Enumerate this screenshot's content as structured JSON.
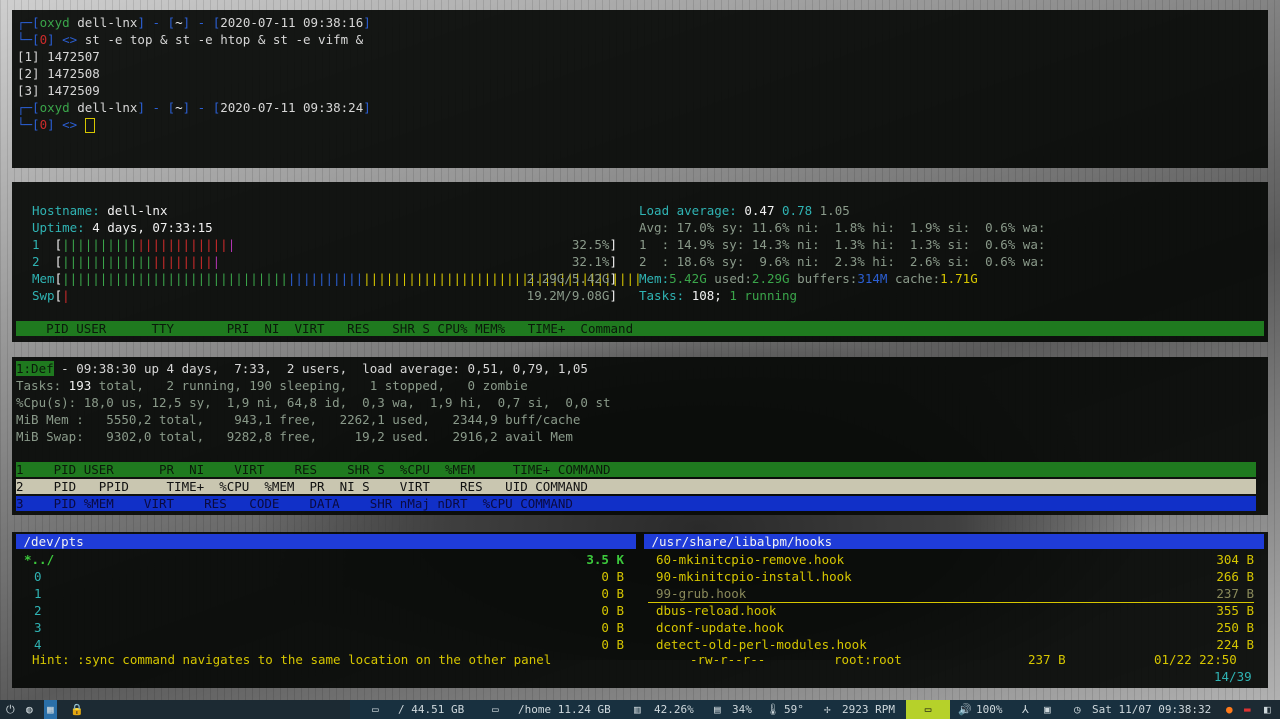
{
  "shell": {
    "prompt1": {
      "user": "oxyd",
      "host": "dell-lnx",
      "dir": "~",
      "time": "2020-07-11 09:38:16"
    },
    "cmd": "st -e top & st -e htop & st -e vifm &",
    "jobs": [
      "[1] 1472507",
      "[2] 1472508",
      "[3] 1472509"
    ],
    "prompt2": {
      "user": "oxyd",
      "host": "dell-lnx",
      "dir": "~",
      "time": "2020-07-11 09:38:24"
    },
    "status": "0"
  },
  "htop": {
    "hostname_label": "Hostname:",
    "hostname": "dell-lnx",
    "uptime_label": "Uptime:",
    "uptime": "4 days, 07:33:15",
    "cpu1_label": "1",
    "cpu1_pct": "32.5%",
    "cpu2_label": "2",
    "cpu2_pct": "32.1%",
    "mem_label": "Mem",
    "mem_val": "2.29G/5.42G",
    "swp_label": "Swp",
    "swp_val": "19.2M/9.08G",
    "load_label": "Load average:",
    "load1": "0.47",
    "load5": "0.78",
    "load15": "1.05",
    "avg_line": "Avg: 17.0% sy: 11.6% ni:  1.8% hi:  1.9% si:  0.6% wa:",
    "c1_line": "1  : 14.9% sy: 14.3% ni:  1.3% hi:  1.3% si:  0.6% wa:",
    "c2_line": "2  : 18.6% sy:  9.6% ni:  2.3% hi:  2.6% si:  0.6% wa:",
    "mem_line_label": "Mem:",
    "mem_total": "5.42G",
    "used_label": "used:",
    "mem_used": "2.29G",
    "buffers_label": "buffers:",
    "buffers": "314M",
    "cache_label": "cache:",
    "cache": "1.71G",
    "tasks_label": "Tasks:",
    "tasks": "108;",
    "running": "1 running",
    "header": "    PID USER      TTY       PRI  NI  VIRT   RES   SHR S CPU% MEM%   TIME+  Command"
  },
  "top": {
    "badge": "1:Def",
    "l1": " - 09:38:30 up 4 days,  7:33,  2 users,  load average: 0,51, 0,79, 1,05",
    "l2_label": "Tasks:",
    "l2_total": " 193",
    "l2_rest": " total,   2 running, 190 sleeping,   1 stopped,   0 zombie",
    "l3": "%Cpu(s): 18,0 us, 12,5 sy,  1,9 ni, 64,8 id,  0,3 wa,  1,9 hi,  0,7 si,  0,0 st",
    "l4": "MiB Mem :   5550,2 total,    943,1 free,   2262,1 used,   2344,9 buff/cache",
    "l5": "MiB Swap:   9302,0 total,   9282,8 free,     19,2 used.   2916,2 avail Mem",
    "h1": "1    PID USER      PR  NI    VIRT    RES    SHR S  %CPU  %MEM     TIME+ COMMAND",
    "h2": "2    PID   PPID     TIME+  %CPU  %MEM  PR  NI S    VIRT    RES   UID COMMAND",
    "h3": "3    PID %MEM    VIRT    RES   CODE    DATA    SHR nMaj nDRT  %CPU COMMAND"
  },
  "vifm": {
    "left_path": " /dev/pts",
    "right_path": " /usr/share/libalpm/hooks",
    "left_items": [
      {
        "name": "*../",
        "size": "3.5 K"
      },
      {
        "name": "0",
        "size": "0 B"
      },
      {
        "name": "1",
        "size": "0 B"
      },
      {
        "name": "2",
        "size": "0 B"
      },
      {
        "name": "3",
        "size": "0 B"
      },
      {
        "name": "4",
        "size": "0 B"
      }
    ],
    "right_items": [
      {
        "name": "60-mkinitcpio-remove.hook",
        "size": "304 B"
      },
      {
        "name": "90-mkinitcpio-install.hook",
        "size": "266 B"
      },
      {
        "name": "99-grub.hook",
        "size": "237 B"
      },
      {
        "name": "dbus-reload.hook",
        "size": "355 B"
      },
      {
        "name": "dconf-update.hook",
        "size": "250 B"
      },
      {
        "name": "detect-old-perl-modules.hook",
        "size": "224 B"
      }
    ],
    "hint": "Hint: :sync command navigates to the same location on the other panel",
    "perm": "-rw-r--r--",
    "owner": "root:root",
    "fsize": "237 B",
    "date": "01/22 22:50",
    "pos": "14/39"
  },
  "statusbar": {
    "root_disk": "/ 44.51 GB",
    "home_disk": "/home 11.24 GB",
    "ram": "42.26%",
    "cpu": "34%",
    "temp": "59°",
    "fan": "2923 RPM",
    "vol": "100%",
    "date": "Sat 11/07 09:38:32"
  },
  "colors": {
    "green_bar": "#1f7a1f",
    "selected_bar": "#c9c6b0",
    "blue_bar": "#1130c8",
    "vifm_path": "#1f3cd8"
  }
}
